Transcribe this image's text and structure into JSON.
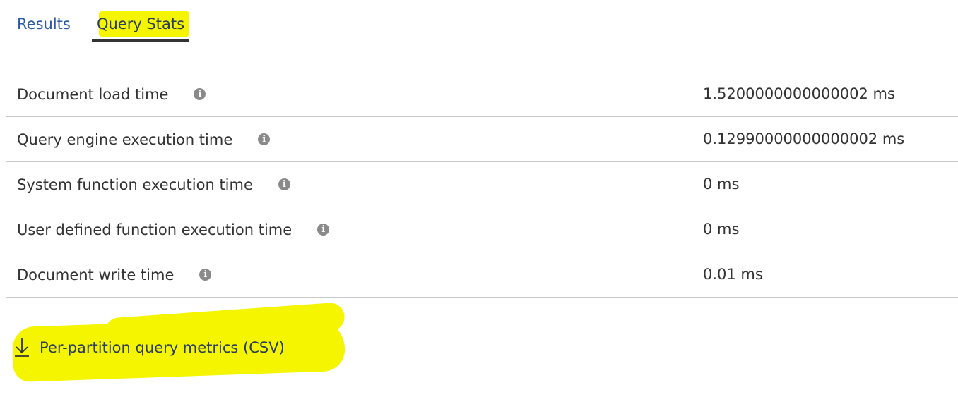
{
  "tabs": [
    {
      "label": "Results",
      "active": false
    },
    {
      "label": "Query Stats",
      "active": true
    }
  ],
  "stats": [
    {
      "label": "Document load time",
      "value": "1.5200000000000002 ms"
    },
    {
      "label": "Query engine execution time",
      "value": "0.12990000000000002 ms"
    },
    {
      "label": "System function execution time",
      "value": "0 ms"
    },
    {
      "label": "User defined function execution time",
      "value": "0 ms"
    },
    {
      "label": "Document write time",
      "value": "0.01 ms"
    }
  ],
  "info_icon": {
    "glyph": "i",
    "name": "info-icon"
  },
  "download": {
    "icon": "download-arrow-icon",
    "label": "Per-partition query metrics (CSV)"
  },
  "colors": {
    "highlight": "#f5f500",
    "tab_link": "#2a5aa8",
    "text": "#333333",
    "divider": "#c8c8c8"
  }
}
